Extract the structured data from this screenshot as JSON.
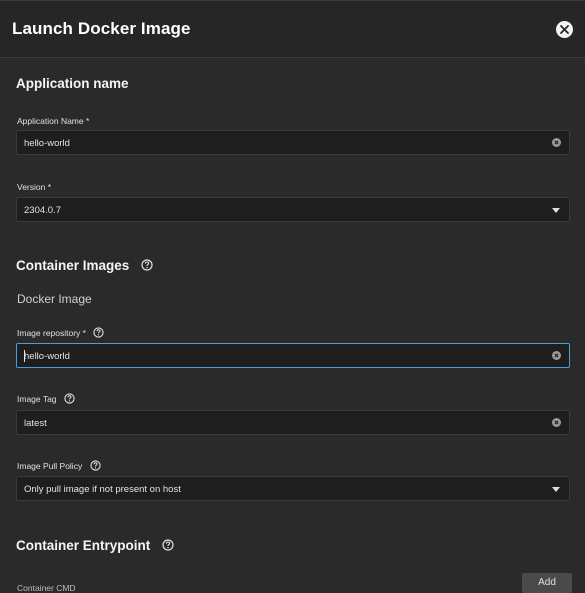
{
  "dialog": {
    "title": "Launch Docker Image"
  },
  "sections": {
    "application_name": {
      "title": "Application name",
      "fields": {
        "app_name": {
          "label": "Application Name *",
          "value": "hello-world"
        },
        "version": {
          "label": "Version *",
          "value": "2304.0.7"
        }
      }
    },
    "container_images": {
      "title": "Container Images",
      "subtitle": "Docker Image",
      "fields": {
        "image_repository": {
          "label": "Image repository *",
          "value": "hello-world"
        },
        "image_tag": {
          "label": "Image Tag",
          "value": "latest"
        },
        "image_pull_policy": {
          "label": "Image Pull Policy",
          "value": "Only pull image if not present on host"
        }
      }
    },
    "container_entrypoint": {
      "title": "Container Entrypoint",
      "partial_label": "Container CMD",
      "add_label": "Add"
    }
  },
  "icons": {
    "close": "close-icon",
    "clear": "clear-icon",
    "caret": "caret-down-icon",
    "help": "help-icon"
  }
}
